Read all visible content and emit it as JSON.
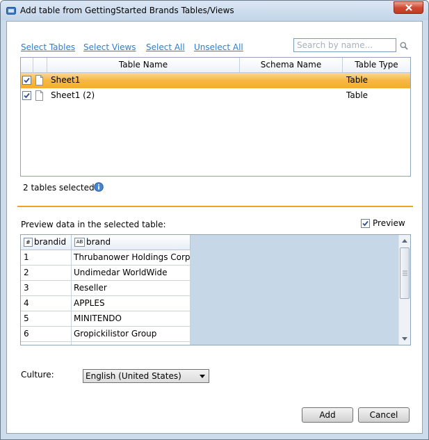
{
  "window": {
    "title": "Add table from GettingStarted Brands Tables/Views"
  },
  "links": {
    "select_tables": "Select Tables",
    "select_views": "Select Views",
    "select_all": "Select All",
    "unselect_all": "Unselect All"
  },
  "search": {
    "placeholder": "Search by name..."
  },
  "tables_grid": {
    "columns": [
      "Table Name",
      "Schema Name",
      "Table Type"
    ],
    "rows": [
      {
        "checked": true,
        "name": "Sheet1",
        "schema": "",
        "type": "Table",
        "selected": true
      },
      {
        "checked": true,
        "name": "Sheet1 (2)",
        "schema": "",
        "type": "Table",
        "selected": false
      }
    ]
  },
  "status": {
    "text": "2 tables selected"
  },
  "preview": {
    "label": "Preview data in the selected table:",
    "toggle_label": "Preview",
    "toggle_checked": true,
    "columns": [
      {
        "name": "brandid",
        "type_icon": "#"
      },
      {
        "name": "brand",
        "type_icon": "AB"
      }
    ],
    "rows": [
      [
        "1",
        "Thrubanower Holdings Corp."
      ],
      [
        "2",
        "Undimedar WorldWide"
      ],
      [
        "3",
        "Reseller"
      ],
      [
        "4",
        "APPLES"
      ],
      [
        "5",
        "MINITENDO"
      ],
      [
        "6",
        "Gropickilistor  Group"
      ]
    ]
  },
  "culture": {
    "label": "Culture:",
    "value": "English (United States)"
  },
  "buttons": {
    "add": "Add",
    "cancel": "Cancel"
  },
  "colors": {
    "accent": "#f0a31e",
    "link": "#2a7dd6",
    "selection": "#f7b947"
  }
}
